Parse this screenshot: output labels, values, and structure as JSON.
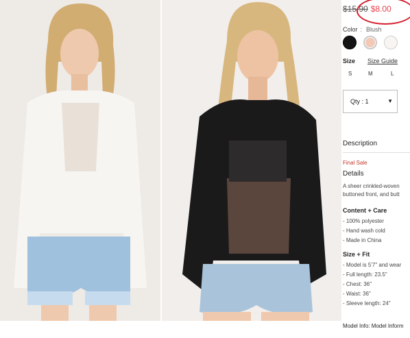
{
  "price": {
    "original": "$15.90",
    "sale": "$8.00",
    "highlight_color": "#d31c2d"
  },
  "color": {
    "label": "Color",
    "separator": ":",
    "selected": "Blush",
    "swatches": [
      {
        "name": "black",
        "hex": "#141414"
      },
      {
        "name": "blush",
        "hex": "#f3c9b6"
      },
      {
        "name": "white",
        "hex": "#f9f5f2"
      }
    ]
  },
  "size": {
    "label": "Size",
    "guide_link": "Size Guide",
    "options": [
      "S",
      "M",
      "L"
    ]
  },
  "quantity": {
    "label": "Qty : 1",
    "caret": "▼"
  },
  "description": {
    "heading": "Description",
    "final_sale": "Final Sale",
    "details_heading": "Details",
    "details_lines": [
      "A sheer crinkled-woven",
      "buttoned front, and butt"
    ]
  },
  "content_care": {
    "heading": "Content + Care",
    "items": [
      "- 100% polyester",
      "- Hand wash cold",
      "- Made in China"
    ]
  },
  "size_fit": {
    "heading": "Size + Fit",
    "items": [
      "- Model is 5'7\" and wear",
      "- Full length: 23.5\"",
      "- Chest: 36\"",
      "- Waist: 36\"",
      "- Sleeve length: 24\""
    ]
  },
  "model_info": "Model Info: Model Inform"
}
